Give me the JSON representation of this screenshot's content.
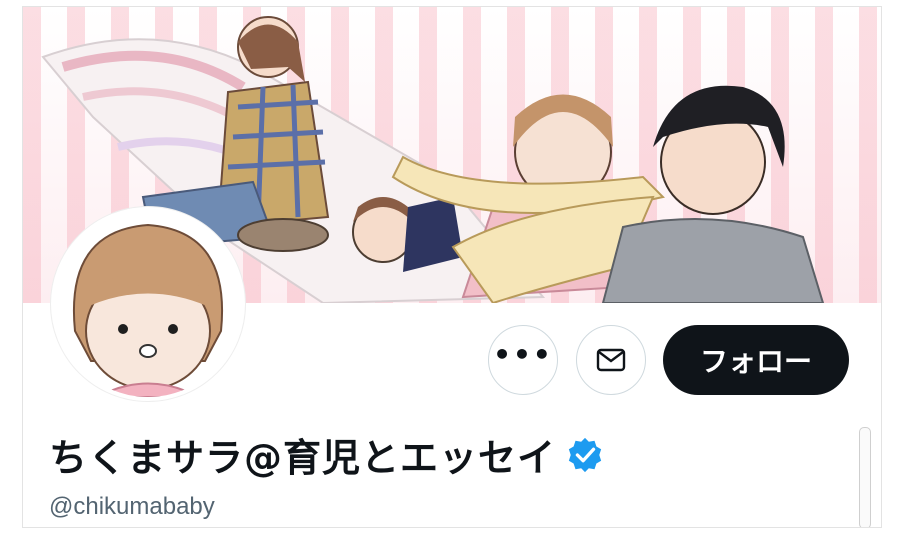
{
  "profile": {
    "display_name": "ちくまサラ@育児とエッセイ",
    "handle": "@chikumababy",
    "verified": true,
    "verified_color": "#1d9bf0"
  },
  "actions": {
    "more_label": "•••",
    "follow_label": "フォロー"
  },
  "icons": {
    "more": "more-horizontal-icon",
    "message": "envelope-icon",
    "verified": "verified-badge-icon"
  },
  "colors": {
    "follow_bg": "#0f1419",
    "follow_text": "#ffffff",
    "handle_text": "#536471"
  }
}
